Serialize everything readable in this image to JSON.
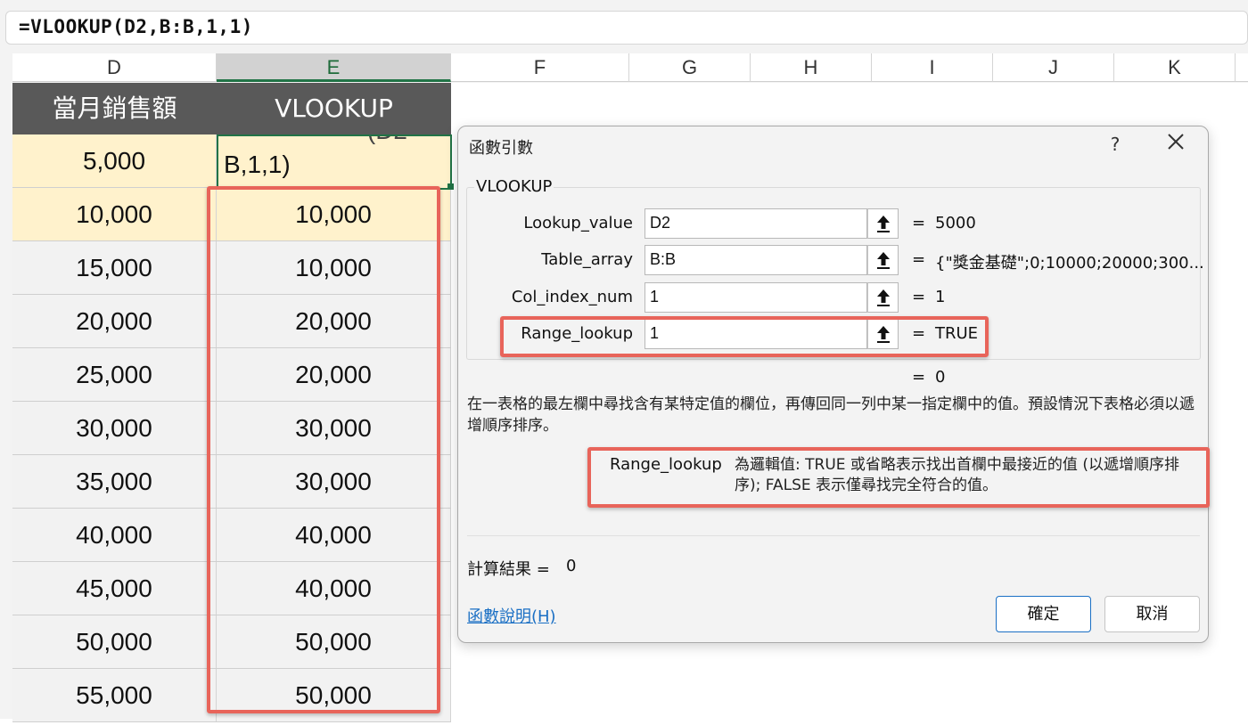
{
  "formula_bar": {
    "formula": "=VLOOKUP(D2,B:B,1,1)"
  },
  "columns": [
    "D",
    "E",
    "F",
    "G",
    "H",
    "I",
    "J",
    "K"
  ],
  "table": {
    "headers": [
      "當月銷售額",
      "VLOOKUP"
    ],
    "editing_cell": {
      "d_value": "5,000",
      "edit_text": "B,1,1)",
      "ghost_text": "(D2"
    },
    "rows": [
      {
        "d": "10,000",
        "e": "10,000"
      },
      {
        "d": "15,000",
        "e": "10,000"
      },
      {
        "d": "20,000",
        "e": "20,000"
      },
      {
        "d": "25,000",
        "e": "20,000"
      },
      {
        "d": "30,000",
        "e": "30,000"
      },
      {
        "d": "35,000",
        "e": "30,000"
      },
      {
        "d": "40,000",
        "e": "40,000"
      },
      {
        "d": "45,000",
        "e": "40,000"
      },
      {
        "d": "50,000",
        "e": "50,000"
      },
      {
        "d": "55,000",
        "e": "50,000"
      }
    ],
    "colors": {
      "header_bg": "#595959",
      "highlight_bg": "#fff2cc",
      "cell_bg": "#f2f2f2",
      "annotation": "#e8645a"
    }
  },
  "dialog": {
    "title": "函數引數",
    "help": "?",
    "close": "✕",
    "function_name": "VLOOKUP",
    "args": [
      {
        "label": "Lookup_value",
        "input": "D2",
        "result": "5000"
      },
      {
        "label": "Table_array",
        "input": "B:B",
        "result": "{\"獎金基礎\";0;10000;20000;300..."
      },
      {
        "label": "Col_index_num",
        "input": "1",
        "result": "1"
      },
      {
        "label": "Range_lookup",
        "input": "1",
        "result": "TRUE"
      }
    ],
    "equals": "=",
    "formula_result": "0",
    "description": "在一表格的最左欄中尋找含有某特定值的欄位，再傳回同一列中某一指定欄中的值。預設情況下表格必須以遞增順序排序。",
    "param_name": "Range_lookup",
    "param_description": "為邏輯值: TRUE 或省略表示找出首欄中最接近的值 (以遞增順序排序); FALSE 表示僅尋找完全符合的值。",
    "calc_label": "計算結果 =",
    "calc_value": "0",
    "help_link": "函數說明(H)",
    "ok_label": "確定",
    "cancel_label": "取消"
  }
}
